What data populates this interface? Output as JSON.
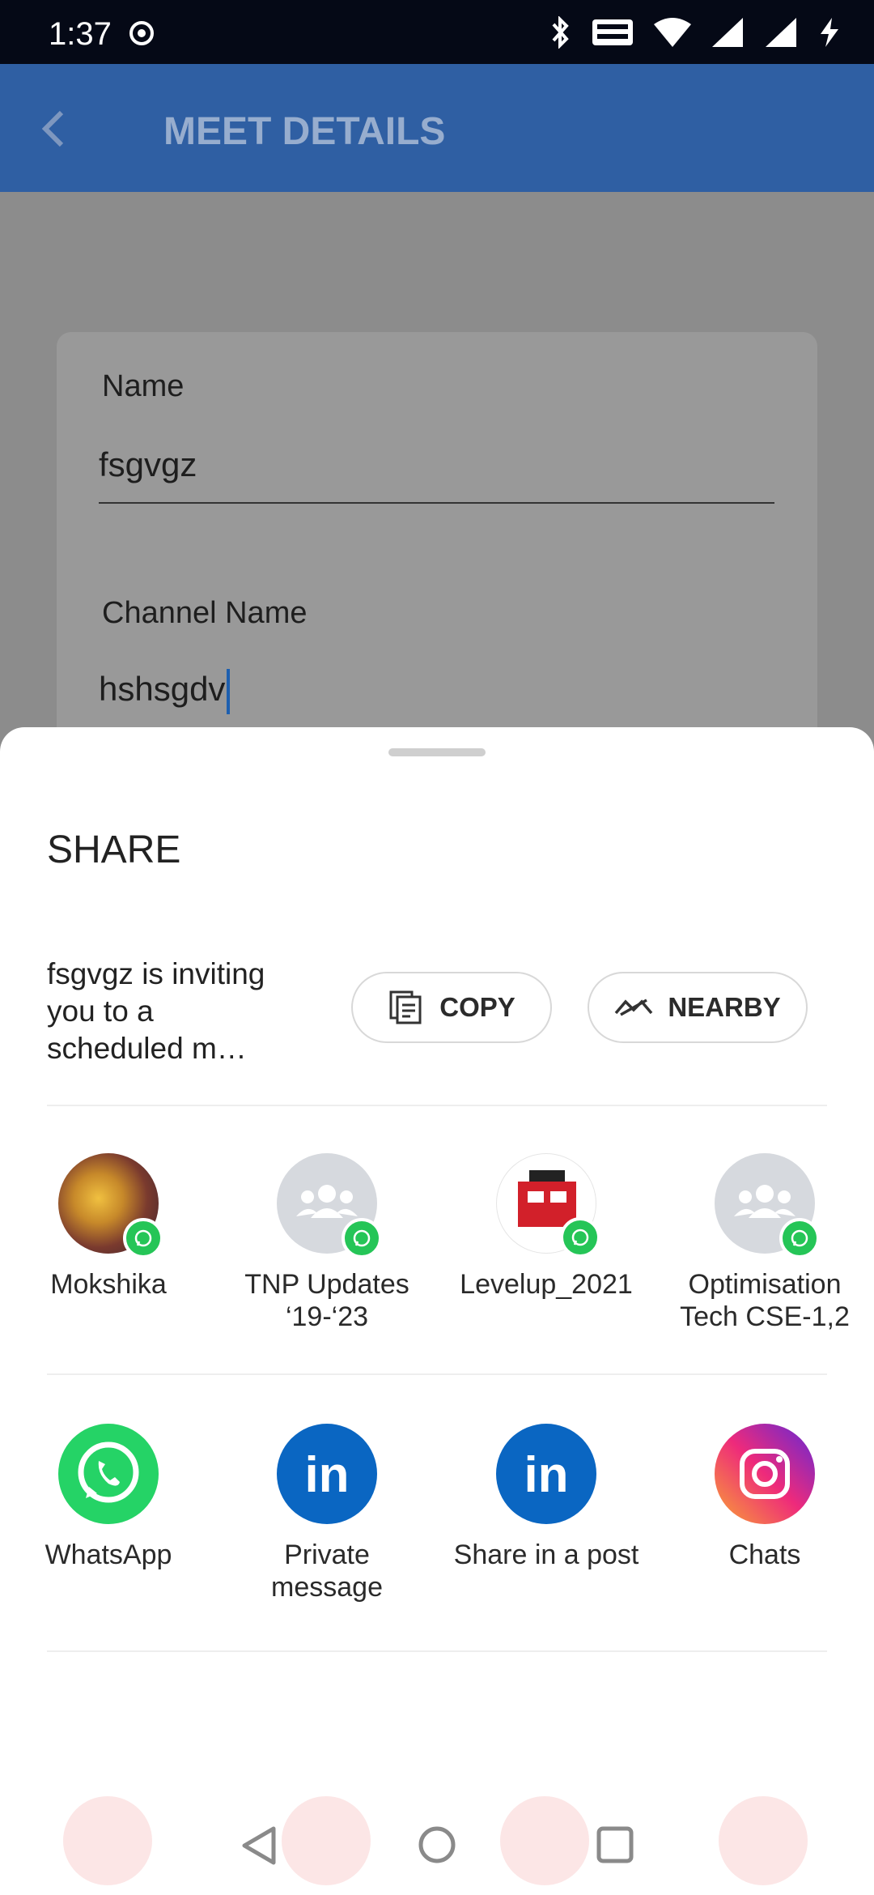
{
  "status": {
    "time": "1:37"
  },
  "appbar": {
    "title": "MEET DETAILS"
  },
  "form": {
    "name_label": "Name",
    "name_value": "fsgvgz",
    "channel_label": "Channel Name",
    "channel_value": "hshsgdv"
  },
  "sheet": {
    "title": "SHARE",
    "message": "fsgvgz is inviting you to a scheduled m…",
    "copy_label": "COPY",
    "nearby_label": "NEARBY",
    "direct_targets": [
      {
        "label": "Mokshika",
        "icon": "whatsapp-badge-icon"
      },
      {
        "label": "TNP Updates ‘19-‘23",
        "icon": "whatsapp-badge-icon"
      },
      {
        "label": "Levelup_2021",
        "icon": "whatsapp-badge-icon"
      },
      {
        "label": "Optimisation Tech CSE-1,2",
        "icon": "whatsapp-badge-icon"
      }
    ],
    "apps": [
      {
        "label": "WhatsApp",
        "icon": "whatsapp-icon",
        "color": "#25D366"
      },
      {
        "label": "Private message",
        "icon": "linkedin-icon",
        "color": "#0A66C2"
      },
      {
        "label": "Share in a post",
        "icon": "linkedin-icon",
        "color": "#0A66C2"
      },
      {
        "label": "Chats",
        "icon": "instagram-icon",
        "color": "#E1306C"
      }
    ]
  }
}
